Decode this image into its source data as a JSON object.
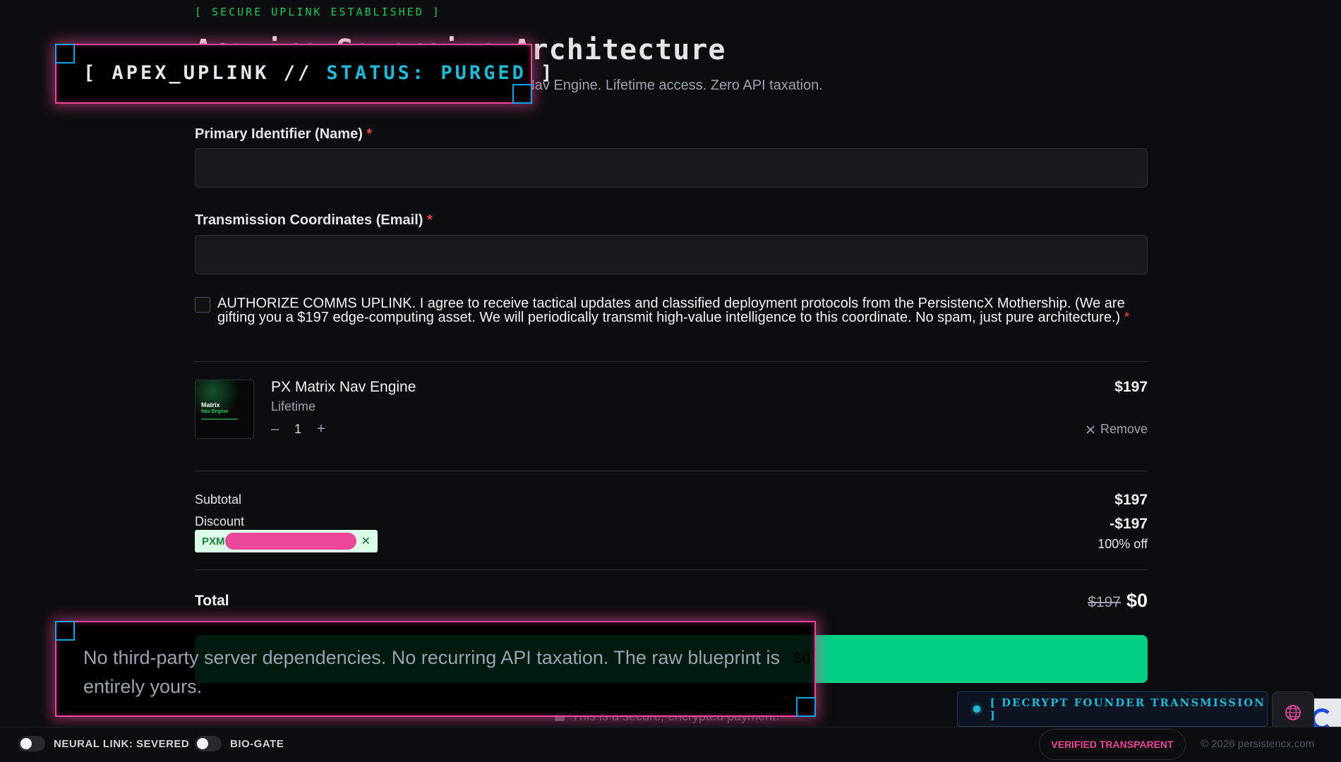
{
  "header": {
    "uplink_status": "[ SECURE UPLINK ESTABLISHED ]",
    "title": "Acquire Sovereign Architecture",
    "subtitle": "You are authorizing the deployment of the PX Matrix Nav Engine. Lifetime access. Zero API taxation."
  },
  "form": {
    "name_label": "Primary Identifier (Name)",
    "name_value": "",
    "email_label": "Transmission Coordinates (Email)",
    "email_value": "",
    "required_marker": "*",
    "consent_text": "AUTHORIZE COMMS UPLINK. I agree to receive tactical updates and classified deployment protocols from the PersistencX Mothership. (We are gifting you a $197 edge-computing asset. We will periodically transmit high-value intelligence to this coordinate. No spam, just pure architecture.)"
  },
  "product": {
    "name": "PX Matrix Nav Engine",
    "plan": "Lifetime",
    "quantity": "1",
    "qty_minus": "–",
    "qty_plus": "+",
    "price": "$197",
    "remove_label": "Remove",
    "remove_icon": "close-icon",
    "thumb_line1": "Matrix",
    "thumb_line2": "Nav Engine"
  },
  "summary": {
    "subtotal_label": "Subtotal",
    "subtotal_value": "$197",
    "discount_label": "Discount",
    "discount_value": "-$197",
    "discount_percent": "100% off",
    "coupon_prefix": "PXM",
    "total_label": "Total",
    "total_old": "$197",
    "total_new": "$0"
  },
  "payment": {
    "button_label": "$0",
    "secure_note": "This is a secure, encrypted payment."
  },
  "overlays": {
    "apex_prefix": "[ APEX_UPLINK // ",
    "apex_status": "STATUS: PURGED",
    "apex_suffix": " ]",
    "message": "No third-party server dependencies. No recurring API taxation. The raw blueprint is entirely yours."
  },
  "decrypt": {
    "label": "[ DECRYPT FOUNDER TRANSMISSION ]"
  },
  "footer": {
    "neural_link_label": "NEURAL LINK: SEVERED",
    "bio_gate_label": "BIO-GATE",
    "verified_label": "VERIFIED TRANSPARENT",
    "copyright": "© 2026 persistencx.com"
  },
  "colors": {
    "accent_green": "#00d084",
    "hud_pink": "#ec4899",
    "hud_cyan": "#22b8d8"
  }
}
